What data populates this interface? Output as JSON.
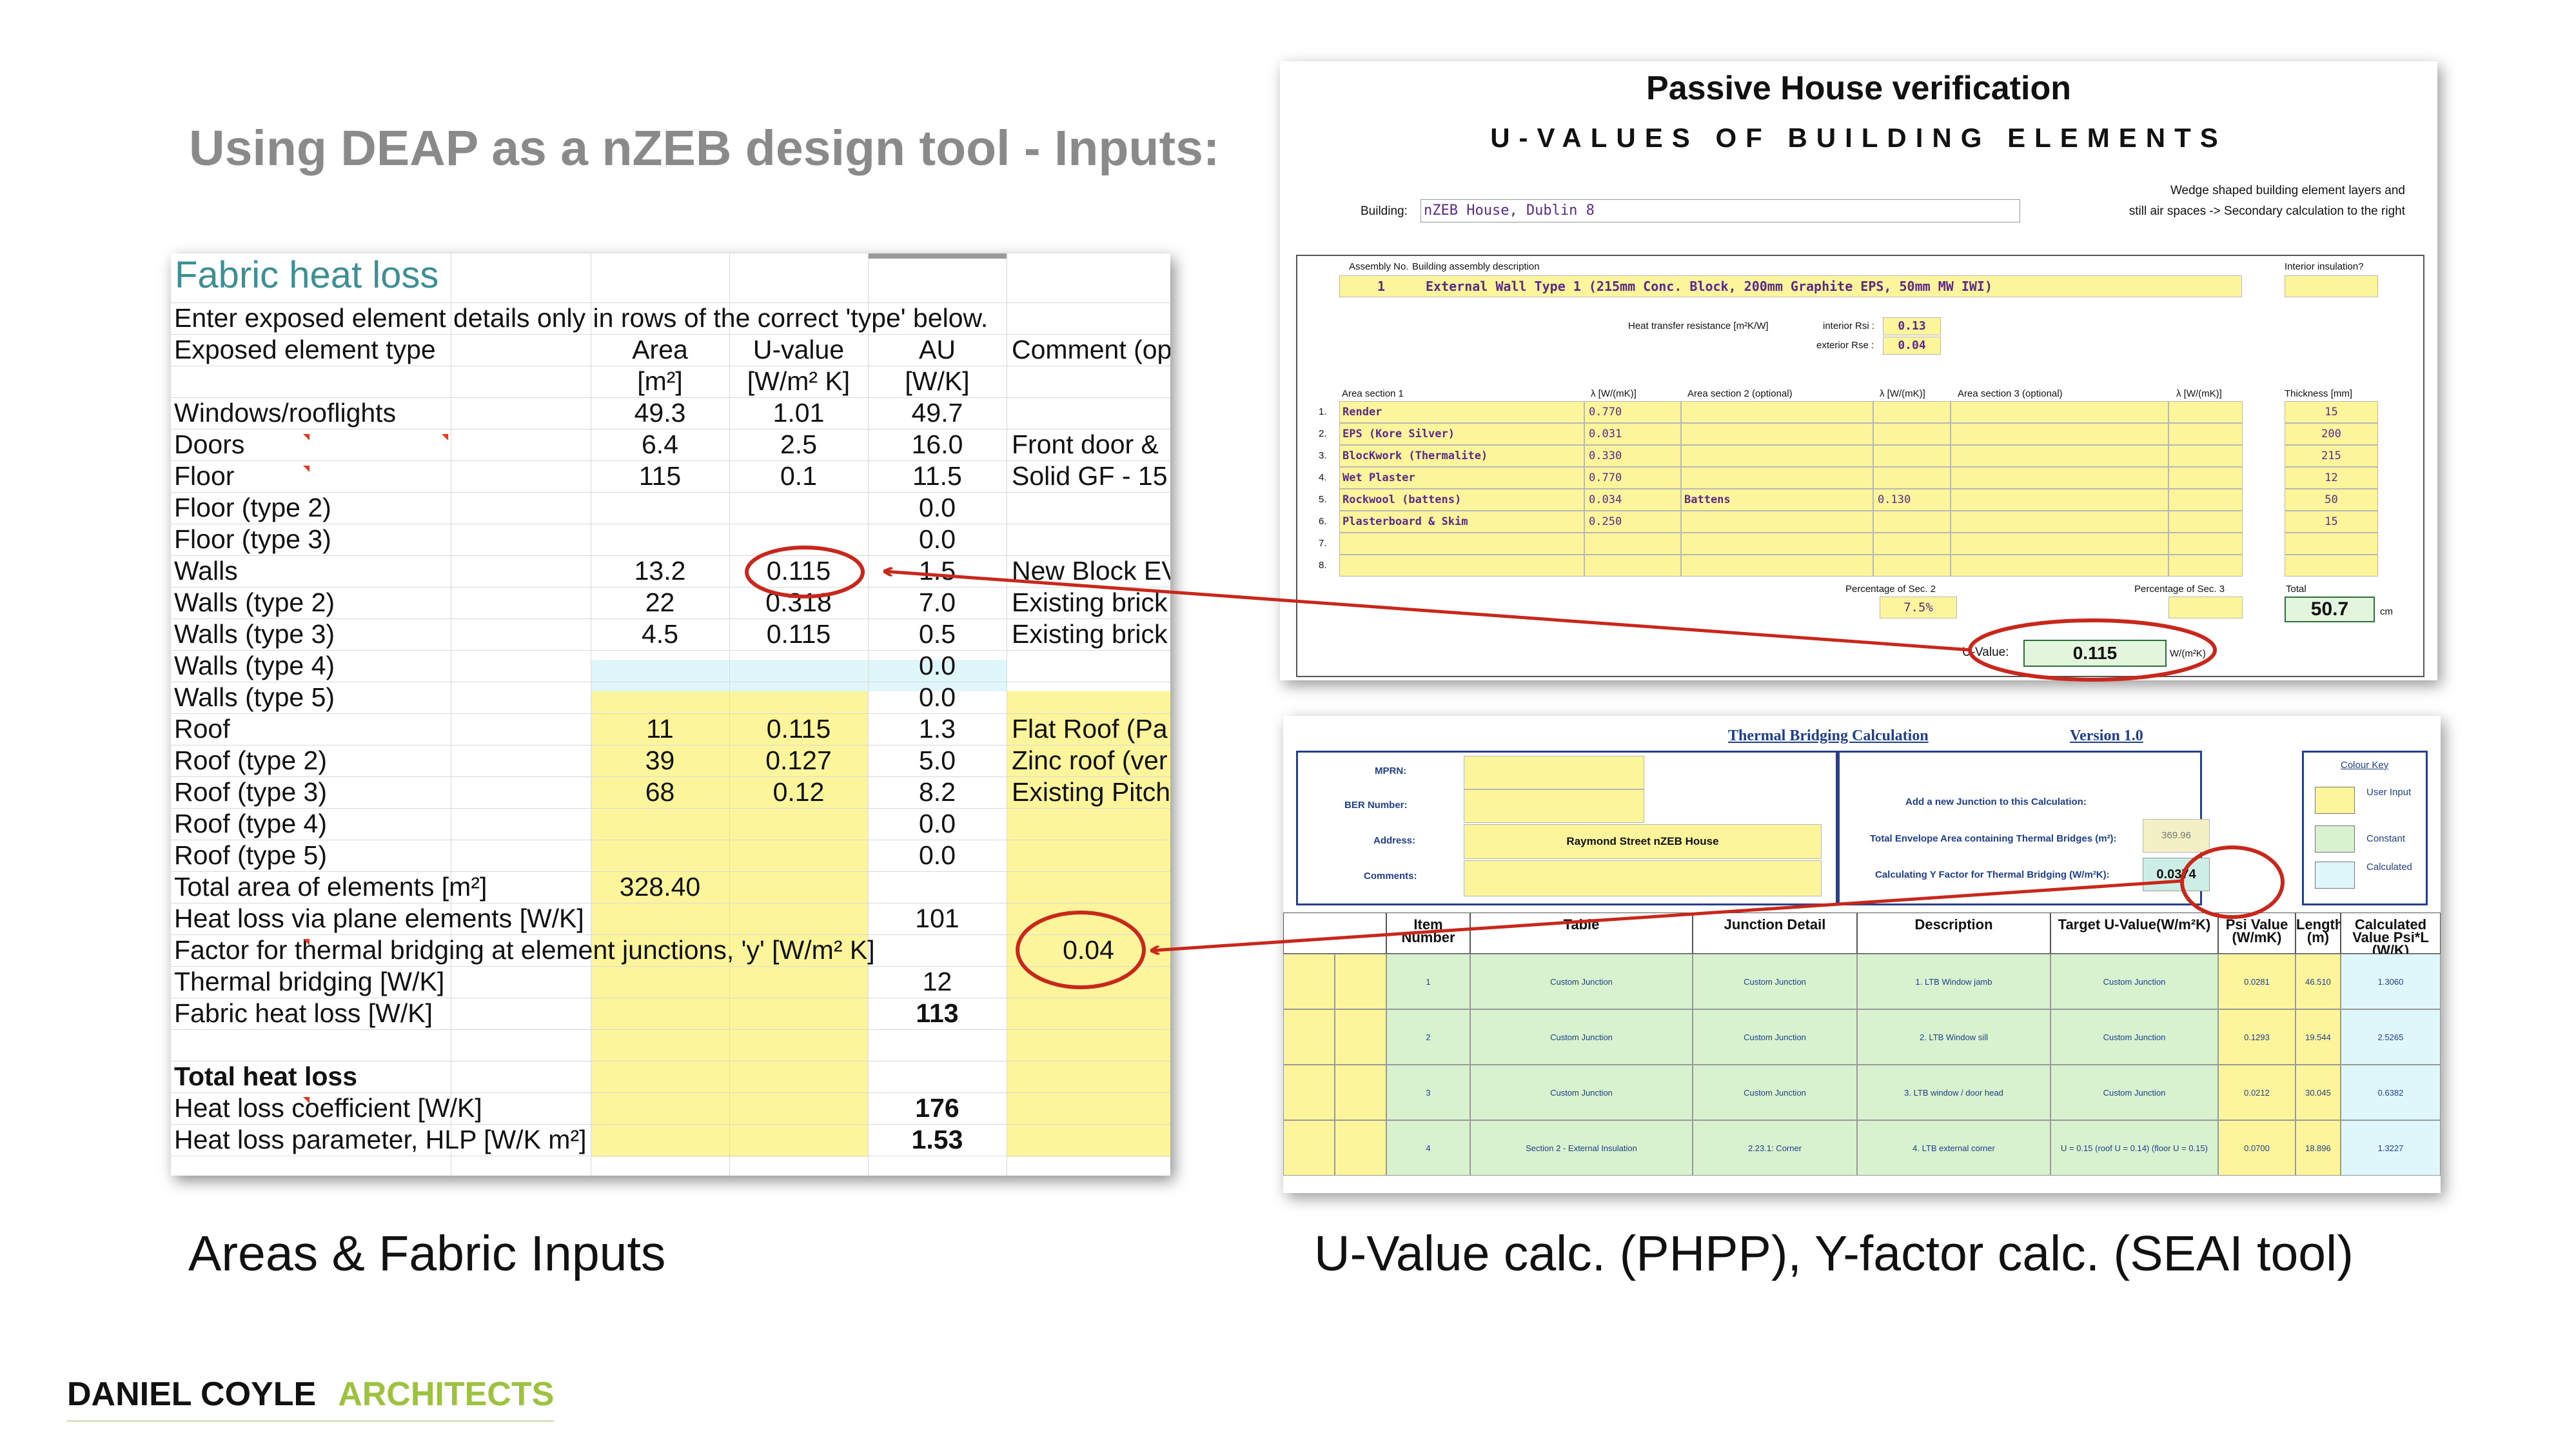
{
  "slide_title": "Using DEAP as a nZEB design tool - Inputs:",
  "captions": {
    "left": "Areas & Fabric Inputs",
    "right": "U-Value calc. (PHPP), Y-factor calc. (SEAI tool)"
  },
  "footer": {
    "name": "DANIEL COYLE",
    "firm": "ARCHITECTS"
  },
  "colors": {
    "cell_yellow": "#fdf59b",
    "cell_cyan": "#dff7fb",
    "annotation_red": "#c8281b",
    "title_grey": "#8a8a8a",
    "firm_green": "#9cc240"
  },
  "fabric": {
    "title": "Fabric heat loss",
    "instruction": "Enter exposed element details only in rows of the correct 'type' below.",
    "headers": {
      "type": "Exposed element type",
      "area": "Area",
      "u": "U-value",
      "au": "AU",
      "comment": "Comment (op"
    },
    "units": {
      "area": "[m²]",
      "u": "[W/m² K]",
      "au": "[W/K]"
    },
    "rows": [
      {
        "label": "Windows/rooflights",
        "area": "49.3",
        "u": "1.01",
        "au": "49.7",
        "comment": ""
      },
      {
        "label": "Doors",
        "area": "6.4",
        "u": "2.5",
        "au": "16.0",
        "comment": "Front door &"
      },
      {
        "label": "Floor",
        "area": "115",
        "u": "0.1",
        "au": "11.5",
        "comment": "Solid GF - 15"
      },
      {
        "label": "Floor (type 2)",
        "area": "",
        "u": "",
        "au": "0.0",
        "comment": ""
      },
      {
        "label": "Floor (type 3)",
        "area": "",
        "u": "",
        "au": "0.0",
        "comment": ""
      },
      {
        "label": "Walls",
        "area": "13.2",
        "u": "0.115",
        "au": "1.5",
        "comment": "New Block EV"
      },
      {
        "label": "Walls (type 2)",
        "area": "22",
        "u": "0.318",
        "au": "7.0",
        "comment": "Existing brick"
      },
      {
        "label": "Walls (type 3)",
        "area": "4.5",
        "u": "0.115",
        "au": "0.5",
        "comment": "Existing brick"
      },
      {
        "label": "Walls (type 4)",
        "area": "",
        "u": "",
        "au": "0.0",
        "comment": ""
      },
      {
        "label": "Walls (type 5)",
        "area": "",
        "u": "",
        "au": "0.0",
        "comment": ""
      },
      {
        "label": "Roof",
        "area": "11",
        "u": "0.115",
        "au": "1.3",
        "comment": "Flat Roof (Pa"
      },
      {
        "label": "Roof (type 2)",
        "area": "39",
        "u": "0.127",
        "au": "5.0",
        "comment": "Zinc roof (ver"
      },
      {
        "label": "Roof (type 3)",
        "area": "68",
        "u": "0.12",
        "au": "8.2",
        "comment": "Existing Pitch"
      },
      {
        "label": "Roof (type 4)",
        "area": "",
        "u": "",
        "au": "0.0",
        "comment": ""
      },
      {
        "label": "Roof (type 5)",
        "area": "",
        "u": "",
        "au": "0.0",
        "comment": ""
      }
    ],
    "total_area_label": "Total area of elements [m²]",
    "total_area": "328.40",
    "plane_label": "Heat loss via plane elements [W/K]",
    "plane_value": "101",
    "y_label": "Factor for thermal bridging at element junctions, 'y' [W/m² K]",
    "y_value": "0.04",
    "tb_label": "Thermal bridging [W/K]",
    "tb_value": "12",
    "fhl_label": "Fabric heat loss [W/K]",
    "fhl_value": "113",
    "total_title": "Total heat loss",
    "hlc_label": "Heat loss coefficient [W/K]",
    "hlc_value": "176",
    "hlp_label": "Heat loss parameter, HLP [W/K m²]",
    "hlp_value": "1.53"
  },
  "phpp": {
    "title": "Passive House verification",
    "subtitle": "U-VALUES OF BUILDING ELEMENTS",
    "note_line1": "Wedge shaped building element layers and",
    "note_line2": "still air spaces -> Secondary calculation to the right",
    "building_label": "Building:",
    "building_value": "nZEB House, Dublin 8",
    "assembly_no_label": "Assembly No.",
    "assembly_desc_label": "Building assembly description",
    "interior_insulation_label": "Interior insulation?",
    "assembly_no": "1",
    "assembly_desc": "External Wall Type 1 (215mm Conc. Block, 200mm Graphite EPS, 50mm MW IWI)",
    "htr_label": "Heat transfer resistance [m²K/W]",
    "rsi_label": "interior Rsi :",
    "rsi_value": "0.13",
    "rse_label": "exterior Rse :",
    "rse_value": "0.04",
    "col_area1": "Area section 1",
    "col_lambda": "λ [W/(mK)]",
    "col_area2": "Area section 2 (optional)",
    "col_area3": "Area section 3 (optional)",
    "col_thickness": "Thickness [mm]",
    "layers": [
      {
        "n": "1.",
        "name": "Render",
        "lambda": "0.770",
        "sec2": "",
        "lambda2": "",
        "thick": "15"
      },
      {
        "n": "2.",
        "name": "EPS (Kore Silver)",
        "lambda": "0.031",
        "sec2": "",
        "lambda2": "",
        "thick": "200"
      },
      {
        "n": "3.",
        "name": "BlocKwork (Thermalite)",
        "lambda": "0.330",
        "sec2": "",
        "lambda2": "",
        "thick": "215"
      },
      {
        "n": "4.",
        "name": "Wet Plaster",
        "lambda": "0.770",
        "sec2": "",
        "lambda2": "",
        "thick": "12"
      },
      {
        "n": "5.",
        "name": "Rockwool (battens)",
        "lambda": "0.034",
        "sec2": "Battens",
        "lambda2": "0.130",
        "thick": "50"
      },
      {
        "n": "6.",
        "name": "Plasterboard & Skim",
        "lambda": "0.250",
        "sec2": "",
        "lambda2": "",
        "thick": "15"
      },
      {
        "n": "7.",
        "name": "",
        "lambda": "",
        "sec2": "",
        "lambda2": "",
        "thick": ""
      },
      {
        "n": "8.",
        "name": "",
        "lambda": "",
        "sec2": "",
        "lambda2": "",
        "thick": ""
      }
    ],
    "pct2_label": "Percentage of Sec. 2",
    "pct2_value": "7.5%",
    "pct3_label": "Percentage of Sec. 3",
    "total_label": "Total",
    "total_value": "50.7",
    "total_unit": "cm",
    "u_label": "U-Value:",
    "u_value": "0.115",
    "u_unit": "W/(m²K)"
  },
  "tb": {
    "title": "Thermal Bridging Calculation",
    "version": "Version 1.0",
    "mprn_label": "MPRN:",
    "ber_label": "BER Number:",
    "address_label": "Address:",
    "address_value": "Raymond Street nZEB House",
    "comments_label": "Comments:",
    "add_junction": "Add a new Junction to this Calculation:",
    "envelope_label": "Total Envelope Area containing Thermal Bridges (m²):",
    "envelope_value": "369.96",
    "y_label": "Calculating Y Factor for Thermal Bridging (W/m²K):",
    "y_value": "0.0374",
    "key_title": "Colour Key",
    "key_user": "User Input",
    "key_constant": "Constant",
    "key_calculated": "Calculated",
    "headers": [
      "Item Number",
      "Table",
      "Junction Detail",
      "Description",
      "Target U-Value(W/m²K)",
      "Psi Value (W/mK)",
      "Length (m)",
      "Calculated Value Psi*L (W/K)"
    ],
    "rows": [
      {
        "item": "1",
        "table": "Custom Junction",
        "detail": "Custom Junction",
        "desc": "1. LTB Window jamb",
        "target": "Custom Junction",
        "psi": "0.0281",
        "len": "46.510",
        "calc": "1.3060"
      },
      {
        "item": "2",
        "table": "Custom Junction",
        "detail": "Custom Junction",
        "desc": "2. LTB Window sill",
        "target": "Custom Junction",
        "psi": "0.1293",
        "len": "19.544",
        "calc": "2.5265"
      },
      {
        "item": "3",
        "table": "Custom Junction",
        "detail": "Custom Junction",
        "desc": "3. LTB window / door head",
        "target": "Custom Junction",
        "psi": "0.0212",
        "len": "30.045",
        "calc": "0.6382"
      },
      {
        "item": "4",
        "table": "Section 2 - External Insulation",
        "detail": "2.23.1: Corner",
        "desc": "4. LTB external corner",
        "target": "U = 0.15 (roof U = 0.14) (floor U = 0.15)",
        "psi": "0.0700",
        "len": "18.896",
        "calc": "1.3227"
      }
    ]
  }
}
